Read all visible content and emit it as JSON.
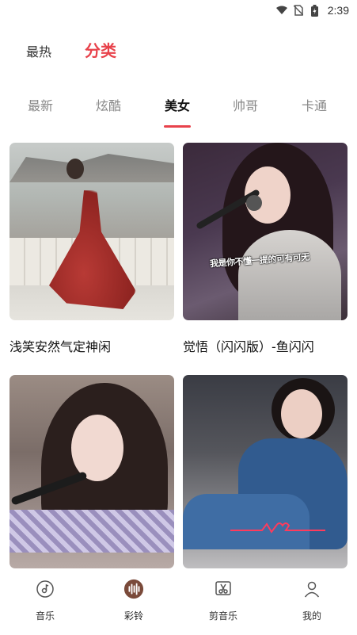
{
  "status_bar": {
    "time": "2:39",
    "icons": [
      "wifi-icon",
      "no-sim-icon",
      "battery-icon"
    ]
  },
  "top_tabs": [
    {
      "label": "最热",
      "active": false
    },
    {
      "label": "分类",
      "active": true
    }
  ],
  "category_tabs": [
    {
      "label": "最新",
      "active": false
    },
    {
      "label": "炫酷",
      "active": false
    },
    {
      "label": "美女",
      "active": true
    },
    {
      "label": "帅哥",
      "active": false
    },
    {
      "label": "卡通",
      "active": false
    }
  ],
  "cards": [
    {
      "title": "浅笑安然气定神闲",
      "caption": ""
    },
    {
      "title": "觉悟（闪闪版）-鱼闪闪",
      "caption": "我是你不懂一提的可有可无"
    },
    {
      "title": "",
      "caption": ""
    },
    {
      "title": "",
      "caption": ""
    }
  ],
  "bottom_nav": [
    {
      "label": "音乐",
      "icon": "music-disc-icon",
      "active": false
    },
    {
      "label": "彩铃",
      "icon": "audio-wave-icon",
      "active": true
    },
    {
      "label": "剪音乐",
      "icon": "scissors-icon",
      "active": false
    },
    {
      "label": "我的",
      "icon": "user-icon",
      "active": false
    }
  ],
  "colors": {
    "accent": "#e8424b",
    "nav_active_bg": "#7a4a3a"
  }
}
